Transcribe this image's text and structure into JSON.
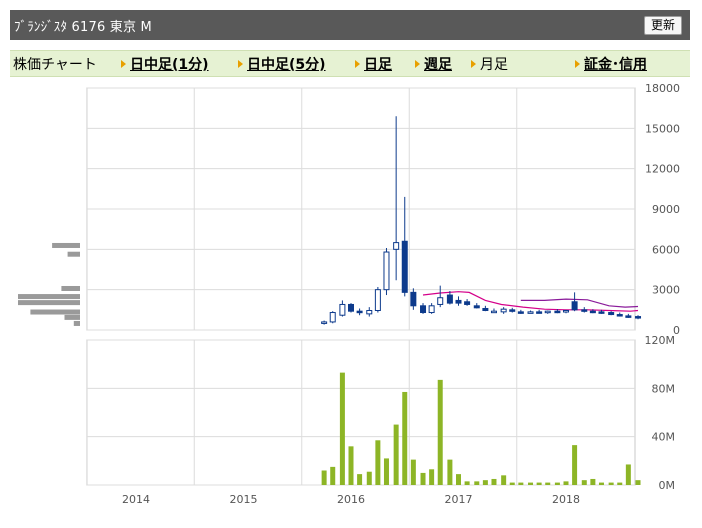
{
  "header": {
    "title": "ﾌﾞﾗﾝｼﾞｽﾀ  6176  東京 M",
    "refresh_label": "更新"
  },
  "nav": {
    "items": [
      {
        "label": "株価チャート",
        "link": false
      },
      {
        "label": "日中足(1分)",
        "link": true
      },
      {
        "label": "日中足(5分)",
        "link": true
      },
      {
        "label": "日足",
        "link": true
      },
      {
        "label": "週足",
        "link": true
      },
      {
        "label": "月足",
        "link": false
      },
      {
        "label": "証金･信用",
        "link": true
      }
    ]
  },
  "chart_data": {
    "type": "candlestick",
    "x_ticks": [
      "2014",
      "2015",
      "2016",
      "2017",
      "2018"
    ],
    "price_axis": {
      "range": [
        0,
        18000
      ],
      "ticks": [
        "0",
        "3000",
        "6000",
        "9000",
        "12000",
        "15000",
        "18000"
      ]
    },
    "volume_axis": {
      "range": [
        0,
        120
      ],
      "ticks": [
        "0M",
        "40M",
        "80M",
        "120M"
      ]
    },
    "colors": {
      "up": "#ffffff",
      "down": "#0d3a8c",
      "candle_edge": "#0d3a8c",
      "ma_short": "#d4008a",
      "ma_long": "#8a1a9a",
      "volume": "#8db526",
      "volume_profile": "#9a9a9a"
    },
    "candles": [
      {
        "t": 2015.75,
        "o": 500,
        "h": 700,
        "l": 400,
        "c": 600
      },
      {
        "t": 2015.83,
        "o": 600,
        "h": 1400,
        "l": 500,
        "c": 1300
      },
      {
        "t": 2015.92,
        "o": 1100,
        "h": 2200,
        "l": 1000,
        "c": 1900
      },
      {
        "t": 2016.0,
        "o": 1900,
        "h": 2000,
        "l": 1300,
        "c": 1400
      },
      {
        "t": 2016.08,
        "o": 1400,
        "h": 1600,
        "l": 1100,
        "c": 1300
      },
      {
        "t": 2016.17,
        "o": 1200,
        "h": 1700,
        "l": 1000,
        "c": 1450
      },
      {
        "t": 2016.25,
        "o": 1450,
        "h": 3200,
        "l": 1300,
        "c": 3000
      },
      {
        "t": 2016.33,
        "o": 3000,
        "h": 6100,
        "l": 2600,
        "c": 5800
      },
      {
        "t": 2016.42,
        "o": 6000,
        "h": 15900,
        "l": 3700,
        "c": 6500
      },
      {
        "t": 2016.5,
        "o": 6600,
        "h": 9900,
        "l": 2500,
        "c": 2800
      },
      {
        "t": 2016.58,
        "o": 2800,
        "h": 3100,
        "l": 1500,
        "c": 1800
      },
      {
        "t": 2016.67,
        "o": 1800,
        "h": 2000,
        "l": 1200,
        "c": 1300
      },
      {
        "t": 2016.75,
        "o": 1300,
        "h": 2000,
        "l": 1200,
        "c": 1800
      },
      {
        "t": 2016.83,
        "o": 1900,
        "h": 3300,
        "l": 1700,
        "c": 2400
      },
      {
        "t": 2016.92,
        "o": 2600,
        "h": 2900,
        "l": 1900,
        "c": 2000
      },
      {
        "t": 2017.0,
        "o": 2200,
        "h": 2500,
        "l": 1800,
        "c": 2000
      },
      {
        "t": 2017.08,
        "o": 2100,
        "h": 2300,
        "l": 1800,
        "c": 1900
      },
      {
        "t": 2017.17,
        "o": 1800,
        "h": 2000,
        "l": 1600,
        "c": 1650
      },
      {
        "t": 2017.25,
        "o": 1600,
        "h": 1800,
        "l": 1400,
        "c": 1450
      },
      {
        "t": 2017.33,
        "o": 1400,
        "h": 1600,
        "l": 1300,
        "c": 1400
      },
      {
        "t": 2017.42,
        "o": 1350,
        "h": 1700,
        "l": 1200,
        "c": 1550
      },
      {
        "t": 2017.5,
        "o": 1500,
        "h": 1650,
        "l": 1300,
        "c": 1400
      },
      {
        "t": 2017.58,
        "o": 1350,
        "h": 1500,
        "l": 1200,
        "c": 1300
      },
      {
        "t": 2017.67,
        "o": 1300,
        "h": 1450,
        "l": 1250,
        "c": 1350
      },
      {
        "t": 2017.75,
        "o": 1350,
        "h": 1500,
        "l": 1250,
        "c": 1300
      },
      {
        "t": 2017.83,
        "o": 1300,
        "h": 1450,
        "l": 1200,
        "c": 1400
      },
      {
        "t": 2017.92,
        "o": 1400,
        "h": 1550,
        "l": 1250,
        "c": 1350
      },
      {
        "t": 2018.0,
        "o": 1350,
        "h": 1500,
        "l": 1250,
        "c": 1450
      },
      {
        "t": 2018.08,
        "o": 2100,
        "h": 2800,
        "l": 1400,
        "c": 1500
      },
      {
        "t": 2018.17,
        "o": 1500,
        "h": 1700,
        "l": 1300,
        "c": 1400
      },
      {
        "t": 2018.25,
        "o": 1400,
        "h": 1550,
        "l": 1250,
        "c": 1350
      },
      {
        "t": 2018.33,
        "o": 1350,
        "h": 1500,
        "l": 1200,
        "c": 1300
      },
      {
        "t": 2018.42,
        "o": 1300,
        "h": 1400,
        "l": 1100,
        "c": 1150
      },
      {
        "t": 2018.5,
        "o": 1150,
        "h": 1300,
        "l": 1000,
        "c": 1050
      },
      {
        "t": 2018.58,
        "o": 1050,
        "h": 1200,
        "l": 900,
        "c": 950
      },
      {
        "t": 2018.67,
        "o": 1000,
        "h": 1100,
        "l": 800,
        "c": 900
      }
    ],
    "ma_short": [
      [
        2016.67,
        2600
      ],
      [
        2016.83,
        2750
      ],
      [
        2017.0,
        2850
      ],
      [
        2017.1,
        2800
      ],
      [
        2017.25,
        2200
      ],
      [
        2017.4,
        1900
      ],
      [
        2017.6,
        1700
      ],
      [
        2017.8,
        1550
      ],
      [
        2018.0,
        1500
      ],
      [
        2018.2,
        1500
      ],
      [
        2018.4,
        1450
      ],
      [
        2018.6,
        1400
      ],
      [
        2018.67,
        1450
      ]
    ],
    "ma_long": [
      [
        2017.58,
        2200
      ],
      [
        2017.8,
        2200
      ],
      [
        2018.0,
        2300
      ],
      [
        2018.2,
        2250
      ],
      [
        2018.4,
        1800
      ],
      [
        2018.55,
        1700
      ],
      [
        2018.67,
        1750
      ]
    ],
    "volume": [
      {
        "t": 2015.75,
        "v": 12
      },
      {
        "t": 2015.83,
        "v": 15
      },
      {
        "t": 2015.92,
        "v": 93
      },
      {
        "t": 2016.0,
        "v": 32
      },
      {
        "t": 2016.08,
        "v": 9
      },
      {
        "t": 2016.17,
        "v": 11
      },
      {
        "t": 2016.25,
        "v": 37
      },
      {
        "t": 2016.33,
        "v": 22
      },
      {
        "t": 2016.42,
        "v": 50
      },
      {
        "t": 2016.5,
        "v": 77
      },
      {
        "t": 2016.58,
        "v": 21
      },
      {
        "t": 2016.67,
        "v": 10
      },
      {
        "t": 2016.75,
        "v": 13
      },
      {
        "t": 2016.83,
        "v": 87
      },
      {
        "t": 2016.92,
        "v": 21
      },
      {
        "t": 2017.0,
        "v": 9
      },
      {
        "t": 2017.08,
        "v": 3
      },
      {
        "t": 2017.17,
        "v": 3
      },
      {
        "t": 2017.25,
        "v": 4
      },
      {
        "t": 2017.33,
        "v": 5
      },
      {
        "t": 2017.42,
        "v": 8
      },
      {
        "t": 2017.5,
        "v": 2
      },
      {
        "t": 2017.58,
        "v": 2
      },
      {
        "t": 2017.67,
        "v": 2
      },
      {
        "t": 2017.75,
        "v": 2
      },
      {
        "t": 2017.83,
        "v": 2
      },
      {
        "t": 2017.92,
        "v": 2
      },
      {
        "t": 2018.0,
        "v": 3
      },
      {
        "t": 2018.08,
        "v": 33
      },
      {
        "t": 2018.17,
        "v": 4
      },
      {
        "t": 2018.25,
        "v": 5
      },
      {
        "t": 2018.33,
        "v": 2
      },
      {
        "t": 2018.42,
        "v": 2
      },
      {
        "t": 2018.5,
        "v": 2
      },
      {
        "t": 2018.58,
        "v": 17
      },
      {
        "t": 2018.67,
        "v": 4
      }
    ],
    "volume_profile": [
      {
        "price": 6250,
        "v": 0.45
      },
      {
        "price": 5600,
        "v": 0.2
      },
      {
        "price": 3050,
        "v": 0.3
      },
      {
        "price": 2450,
        "v": 1.0
      },
      {
        "price": 2000,
        "v": 1.0
      },
      {
        "price": 1300,
        "v": 0.8
      },
      {
        "price": 900,
        "v": 0.25
      },
      {
        "price": 450,
        "v": 0.1
      }
    ]
  }
}
